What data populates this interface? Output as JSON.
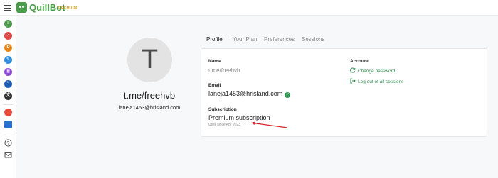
{
  "app": {
    "name": "QuillBot",
    "badge": "PREMIUM",
    "brand_color": "#4a9b4a",
    "badge_color": "#d4a52a"
  },
  "sidebar": {
    "items": [
      {
        "name": "paraphraser-icon",
        "color": "#4a9b4a",
        "glyph": "≡"
      },
      {
        "name": "grammar-checker-icon",
        "color": "#e04a4a",
        "glyph": "✓"
      },
      {
        "name": "plagiarism-checker-icon",
        "color": "#e8891a",
        "glyph": "P"
      },
      {
        "name": "co-writer-icon",
        "color": "#2f8fe0",
        "glyph": "✎"
      },
      {
        "name": "summarizer-icon",
        "color": "#8e4ad6",
        "glyph": "≣"
      },
      {
        "name": "citation-generator-icon",
        "color": "#1d5fb5",
        "glyph": "“"
      },
      {
        "name": "translator-icon",
        "color": "#333333",
        "glyph": "文"
      }
    ],
    "extensions": [
      {
        "name": "chrome-extension-icon",
        "color": "#e74c3c"
      },
      {
        "name": "word-extension-icon",
        "color": "#2b6fd1"
      }
    ],
    "bottom": [
      {
        "name": "help-icon",
        "glyph": "?"
      },
      {
        "name": "mail-icon",
        "glyph": "✉"
      }
    ]
  },
  "profile": {
    "avatar_letter": "T",
    "name": "t.me/freehvb",
    "email": "laneja1453@hrisland.com"
  },
  "tabs": [
    {
      "label": "Profile",
      "active": true
    },
    {
      "label": "Your Plan",
      "active": false
    },
    {
      "label": "Preferences",
      "active": false
    },
    {
      "label": "Sessions",
      "active": false
    }
  ],
  "card": {
    "name_label": "Name",
    "name_value": "t.me/freehvb",
    "email_label": "Email",
    "email_value": "laneja1453@hrisland.com",
    "subscription_label": "Subscription",
    "subscription_value": "Premium subscription",
    "subscription_since": "User since Apr 2023",
    "account_label": "Account",
    "change_password": "Change password",
    "logout_all": "Log out of all sessions",
    "link_color": "#2e8b4e"
  }
}
